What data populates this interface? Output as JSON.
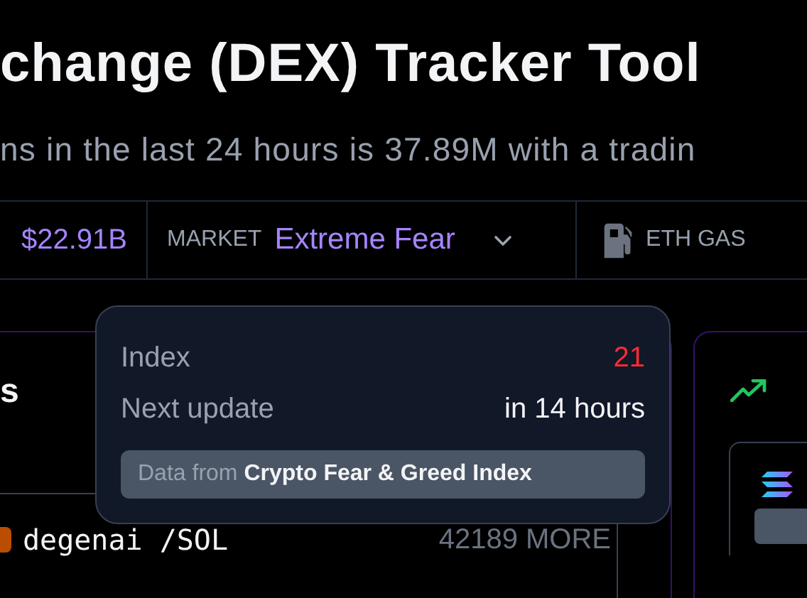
{
  "header": {
    "title": "change (DEX) Tracker Tool",
    "subtitle": "ns in the last 24 hours is 37.89M with a tradin"
  },
  "stats": [
    {
      "kind": "value",
      "value": "$22.91B"
    },
    {
      "kind": "dropdown",
      "label": "MARKET",
      "value": "Extreme Fear",
      "expanded": true
    },
    {
      "kind": "gas",
      "label": "ETH GAS"
    }
  ],
  "popover": {
    "rows": [
      {
        "label": "Index",
        "value": "21",
        "kind": "alert"
      },
      {
        "label": "Next update",
        "value": "in 14 hours",
        "kind": "normal"
      }
    ],
    "source": "Data from **Crypto Fear & Greed Index**"
  },
  "left_panel": {
    "heading": "s",
    "rows": [
      {
        "name": "degenai /SOL",
        "count": "42189 MORE"
      }
    ]
  }
}
